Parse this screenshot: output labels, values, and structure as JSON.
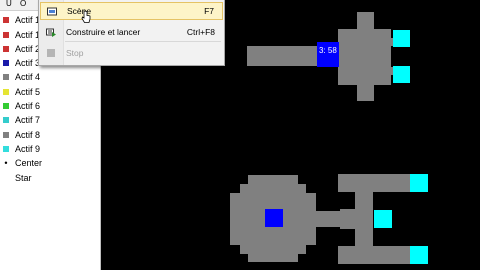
{
  "panel": {
    "toolbar": {
      "u_label": "U",
      "o_label": "O"
    },
    "items": [
      {
        "label": "Actif 1",
        "color": "#cc3333",
        "kind": "square"
      },
      {
        "label": "Actif 1",
        "color": "#cc3333",
        "kind": "square"
      },
      {
        "label": "Actif 2",
        "color": "#cc3333",
        "kind": "square"
      },
      {
        "label": "Actif 3",
        "color": "#1a1aaa",
        "kind": "square"
      },
      {
        "label": "Actif 4",
        "color": "#808080",
        "kind": "square"
      },
      {
        "label": "Actif 5",
        "color": "#e5e533",
        "kind": "square"
      },
      {
        "label": "Actif 6",
        "color": "#33cc33",
        "kind": "square"
      },
      {
        "label": "Actif 7",
        "color": "#33cccc",
        "kind": "square"
      },
      {
        "label": "Actif 8",
        "color": "#808080",
        "kind": "square"
      },
      {
        "label": "Actif 9",
        "color": "#33dddd",
        "kind": "square"
      },
      {
        "label": "Center",
        "kind": "dot",
        "glyph": "•"
      },
      {
        "label": "Star",
        "kind": "none"
      }
    ]
  },
  "menu": {
    "items": [
      {
        "label": "Scène",
        "shortcut": "F7",
        "icon": "scene-icon",
        "state": "hovered"
      },
      {
        "label": "Construire et lancer",
        "shortcut": "Ctrl+F8",
        "icon": "build-run-icon",
        "state": "enabled"
      },
      {
        "label": "Stop",
        "shortcut": "",
        "icon": "stop-icon",
        "state": "disabled"
      }
    ]
  },
  "scene": {
    "rect_label": "3: 58",
    "colors": {
      "background": "#000000",
      "body": "#808080",
      "engine": "#00ffff",
      "core": "#0000ff"
    }
  }
}
